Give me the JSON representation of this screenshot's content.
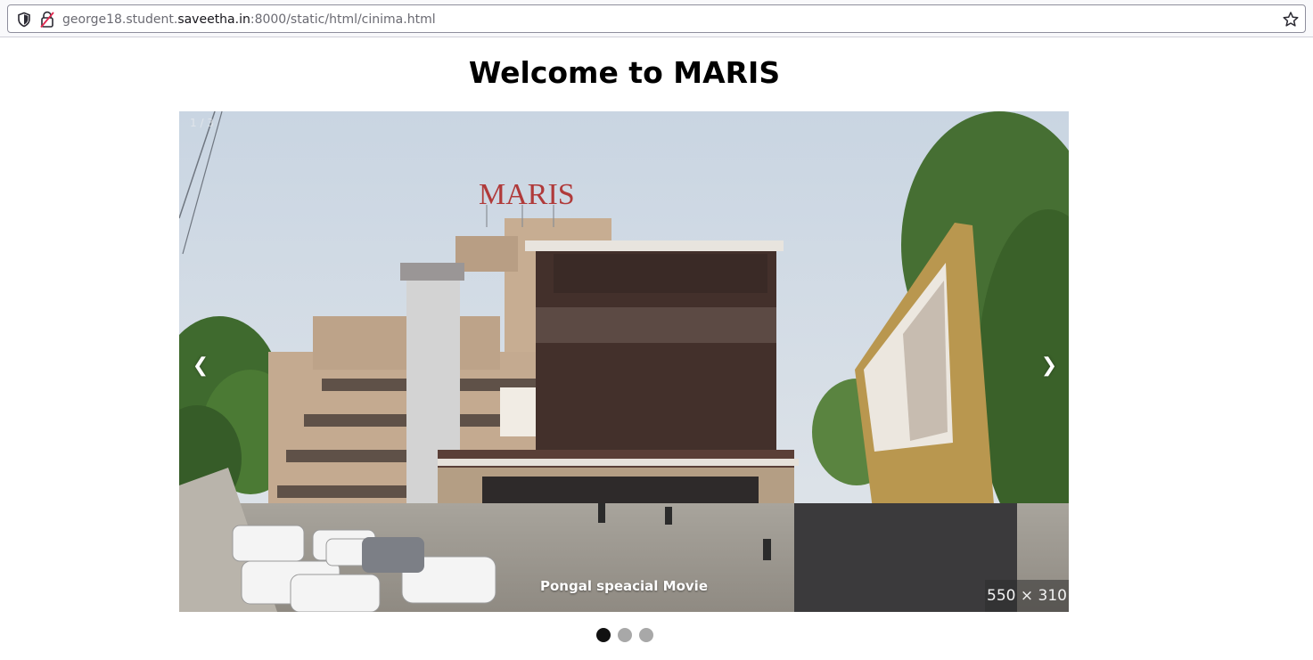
{
  "browser": {
    "url_prefix": "george18.student.",
    "url_domain": "saveetha.in",
    "url_suffix": ":8000/static/html/cinima.html"
  },
  "page": {
    "title": "Welcome to MARIS"
  },
  "slideshow": {
    "slide_number": "1 / 3",
    "prev_symbol": "❮",
    "next_symbol": "❯",
    "caption": "Pongal speacial Movie",
    "dimension_badge": "550 × 310",
    "sign_text": "MARIS",
    "total_slides": 3,
    "active_slide": 1
  },
  "colors": {
    "active_dot": "#111111",
    "inactive_dot": "#a8a8a8"
  }
}
